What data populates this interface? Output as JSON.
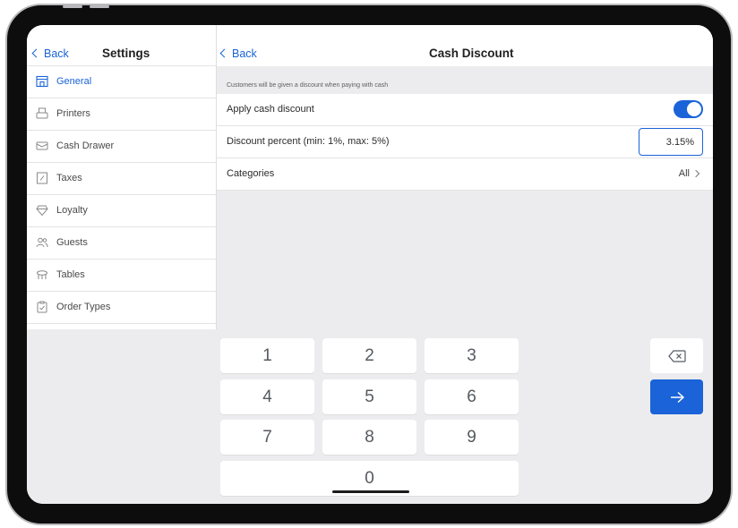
{
  "settings_nav": {
    "back_label": "Back",
    "title": "Settings",
    "items": [
      {
        "label": "General",
        "icon": "store-icon",
        "active": true
      },
      {
        "label": "Printers",
        "icon": "printer-icon"
      },
      {
        "label": "Cash Drawer",
        "icon": "cash-drawer-icon"
      },
      {
        "label": "Taxes",
        "icon": "tax-icon"
      },
      {
        "label": "Loyalty",
        "icon": "diamond-icon"
      },
      {
        "label": "Guests",
        "icon": "guests-icon"
      },
      {
        "label": "Tables",
        "icon": "table-icon"
      },
      {
        "label": "Order Types",
        "icon": "clipboard-check-icon"
      }
    ]
  },
  "detail": {
    "back_label": "Back",
    "title": "Cash Discount",
    "hint": "Customers will be given a discount when paying with cash",
    "apply_label": "Apply cash discount",
    "apply_enabled": true,
    "percent_label": "Discount percent (min: 1%, max: 5%)",
    "percent_value": "3.15%",
    "categories_label": "Categories",
    "categories_value": "All"
  },
  "keypad": {
    "keys": [
      "1",
      "2",
      "3",
      "4",
      "5",
      "6",
      "7",
      "8",
      "9",
      "0"
    ],
    "backspace_icon": "backspace-icon",
    "enter_icon": "arrow-right-icon"
  },
  "colors": {
    "accent": "#1a63d8",
    "background": "#ececee"
  }
}
